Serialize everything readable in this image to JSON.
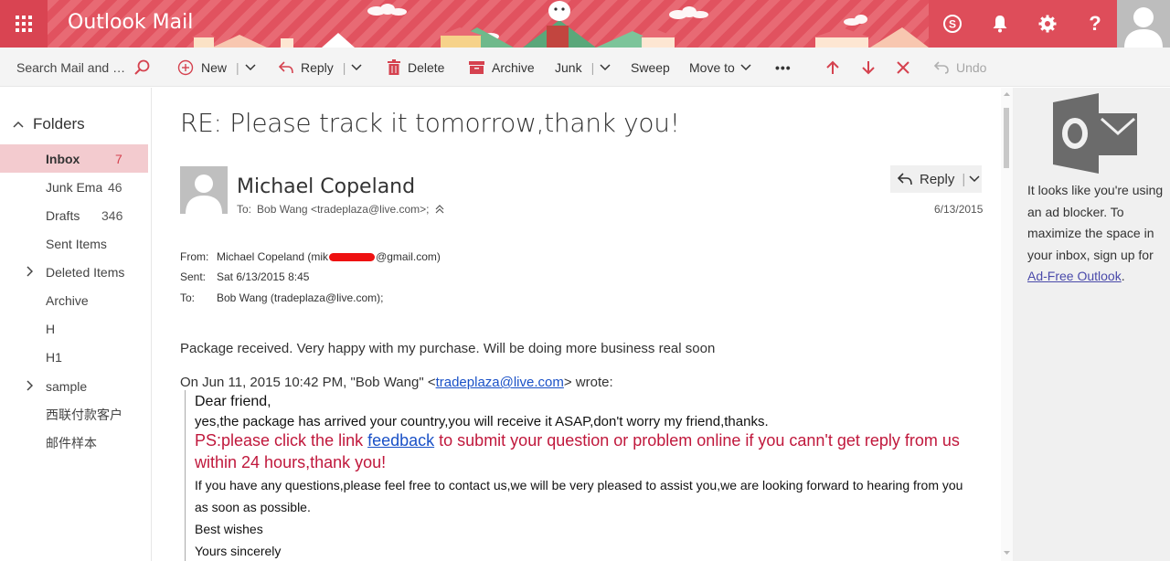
{
  "header": {
    "app_title": "Outlook Mail",
    "accent_color": "#e35a66",
    "icons": [
      "app-launcher-icon",
      "skype-icon",
      "bell-icon",
      "gear-icon",
      "help-icon",
      "user-avatar-icon"
    ]
  },
  "search": {
    "placeholder": "Search Mail and P..."
  },
  "toolbar": {
    "new_label": "New",
    "reply_label": "Reply",
    "delete_label": "Delete",
    "archive_label": "Archive",
    "junk_label": "Junk",
    "sweep_label": "Sweep",
    "moveto_label": "Move to",
    "more_label": "•••",
    "undo_label": "Undo"
  },
  "sidebar": {
    "folders_label": "Folders",
    "items": [
      {
        "label": "Inbox",
        "count": "7"
      },
      {
        "label": "Junk Ema",
        "count": "46"
      },
      {
        "label": "Drafts",
        "count": "346"
      },
      {
        "label": "Sent Items",
        "count": ""
      },
      {
        "label": "Deleted Items",
        "count": ""
      },
      {
        "label": "Archive",
        "count": ""
      },
      {
        "label": "H",
        "count": ""
      },
      {
        "label": "H1",
        "count": ""
      },
      {
        "label": "sample",
        "count": ""
      },
      {
        "label": "西联付款客户",
        "count": ""
      },
      {
        "label": "邮件样本",
        "count": ""
      }
    ]
  },
  "message": {
    "subject": "RE: Please track it tomorrow,thank you!",
    "sender_name": "Michael Copeland",
    "to_label": "To:",
    "to_value": "Bob Wang <tradeplaza@live.com>;",
    "reply_label": "Reply",
    "date": "6/13/2015",
    "from_label": "From:",
    "from_prefix": "Michael Copeland (mik",
    "from_suffix": "@gmail.com)",
    "sent_label": "Sent:",
    "sent_value": "Sat 6/13/2015 8:45",
    "to_label2": "To:",
    "to_value2": "Bob Wang (tradeplaza@live.com);",
    "body": "Package received. Very happy with my purchase. Will be doing more business real soon",
    "quote_intro_prefix": "On Jun 11, 2015 10:42 PM, \"Bob Wang\" <",
    "quote_intro_email": "tradeplaza@live.com",
    "quote_intro_suffix": "> wrote:",
    "quote": {
      "greeting": "Dear friend,",
      "line1": "yes,the package has arrived your country,you will receive it ASAP,don't worry my friend,thanks.",
      "ps_prefix": "PS:please click the link ",
      "ps_link": "feedback",
      "ps_suffix": " to submit your question or problem online if you cann't get reply from us",
      "ps_line2": "within 24 hours,thank you!",
      "line2": "If you have any questions,please feel free to contact us,we will be very pleased to assist you,we are looking forward to hearing from you",
      "line3": "as soon as possible.",
      "line4": "Best wishes",
      "line5": "Yours sincerely"
    }
  },
  "ad": {
    "text": "It looks like you're using an ad blocker. To maximize the space in your inbox, sign up for",
    "link": "Ad-Free Outlook",
    "period": "."
  }
}
